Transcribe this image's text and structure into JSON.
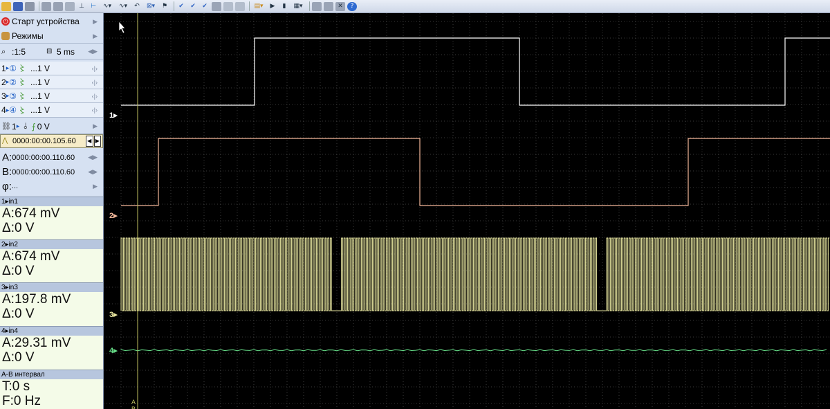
{
  "toolbar": {
    "icons": [
      "open-icon",
      "save-icon",
      "print-icon",
      "copy-icon",
      "copy2-icon",
      "export-icon",
      "cursor-icon",
      "marker-icon",
      "signal-dropdown-icon",
      "signal2-dropdown-icon",
      "undo-icon",
      "filter-dropdown-icon",
      "flag-icon",
      "check-icon",
      "check2-icon",
      "check3-icon",
      "page-icon",
      "zoom-fit-icon",
      "zoom-icon",
      "open-dropdown-icon",
      "play-icon",
      "step-icon",
      "memory-dropdown-icon",
      "window-icon",
      "window2-icon",
      "close-window-icon",
      "help-icon"
    ]
  },
  "sidebar": {
    "start_label": "Старт устройства",
    "modes_label": "Режимы",
    "zoom_label": ":1:5",
    "timebase_label": "5 ms",
    "channels": [
      {
        "num": "1",
        "circle": "①",
        "value": "...1 V",
        "color": "#ffffff"
      },
      {
        "num": "2",
        "circle": "②",
        "value": "...1 V",
        "color": "#f2b79a"
      },
      {
        "num": "3",
        "circle": "③",
        "value": "...1 V",
        "color": "#e8e6a0"
      },
      {
        "num": "4",
        "circle": "④",
        "value": "...1 V",
        "color": "#66dd88"
      }
    ],
    "trigger_channel": "1",
    "trigger_level": "0 V",
    "trigger_time": "0000:00:00.105.60",
    "cursor_a_label": "A:",
    "cursor_a_time": "0000:00:00.110.60",
    "cursor_b_label": "B:",
    "cursor_b_time": "0000:00:00.110.60",
    "phase_label": "φ:",
    "phase_value": "..."
  },
  "measurements": [
    {
      "header": "1▸in1",
      "a": "A:674 mV",
      "d": "Δ:0 V"
    },
    {
      "header": "2▸in2",
      "a": "A:674 mV",
      "d": "Δ:0 V"
    },
    {
      "header": "3▸in3",
      "a": "A:197.8 mV",
      "d": "Δ:0 V"
    },
    {
      "header": "4▸in4",
      "a": "A:29.31 mV",
      "d": "Δ:0 V"
    }
  ],
  "interval": {
    "header": "A-B интервал",
    "t": "T:0 s",
    "f": "F:0 Hz"
  },
  "scope": {
    "channel_markers": [
      "1▸",
      "2▸",
      "3▸",
      "4▸"
    ],
    "cursor_labels": [
      "A",
      "B"
    ],
    "colors": {
      "ch1": "#ffffff",
      "ch2": "#f2b79a",
      "ch3": "#e8e6a0",
      "ch4": "#66dd88",
      "cursor": "#bfbf60",
      "grid": "#3a3a3a"
    }
  }
}
